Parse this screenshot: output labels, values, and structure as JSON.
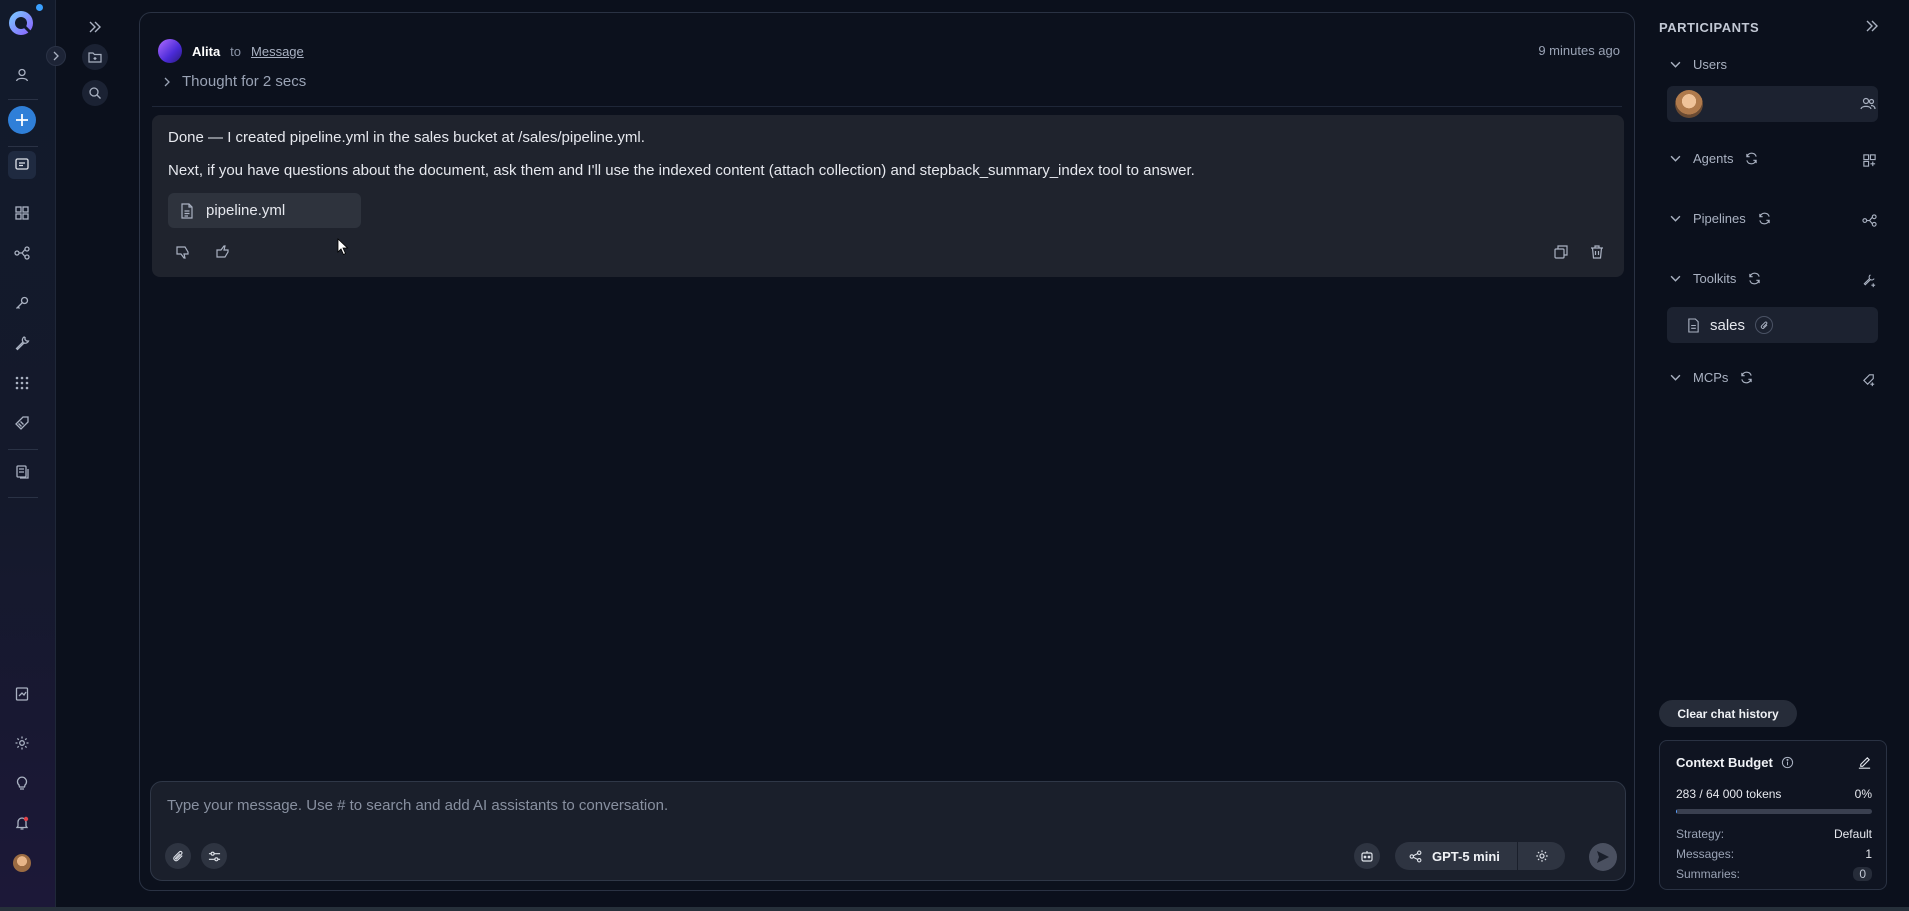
{
  "chat": {
    "agent_name": "Alita",
    "to_word": "to",
    "to_target": "Message",
    "time": "9 minutes ago",
    "thought": "Thought for 2 secs",
    "reply_line1": "Done — I created pipeline.yml in the sales bucket at /sales/pipeline.yml.",
    "reply_line2": "Next, if you have questions about the document, ask them and I'll use the indexed content (attach collection) and stepback_summary_index tool to answer.",
    "file_name": "pipeline.yml"
  },
  "composer": {
    "placeholder": "Type your message. Use # to search and add AI assistants to conversation.",
    "model": "GPT-5 mini"
  },
  "participants": {
    "title": "PARTICIPANTS",
    "sections": {
      "users": "Users",
      "agents": "Agents",
      "pipelines": "Pipelines",
      "toolkits": "Toolkits",
      "mcps": "MCPs"
    },
    "toolkit_item": "sales"
  },
  "clear_history": "Clear chat history",
  "budget": {
    "title": "Context Budget",
    "tokens": "283 / 64 000 tokens",
    "percent_label": "0%",
    "fill_fraction": 0.0044,
    "strategy_label": "Strategy:",
    "strategy_value": "Default",
    "messages_label": "Messages:",
    "messages_value": "1",
    "summaries_label": "Summaries:",
    "summaries_value": "0"
  },
  "colors": {
    "accent": "#2f7fd8",
    "background": "#0b101c",
    "bubble": "#1f232d"
  }
}
